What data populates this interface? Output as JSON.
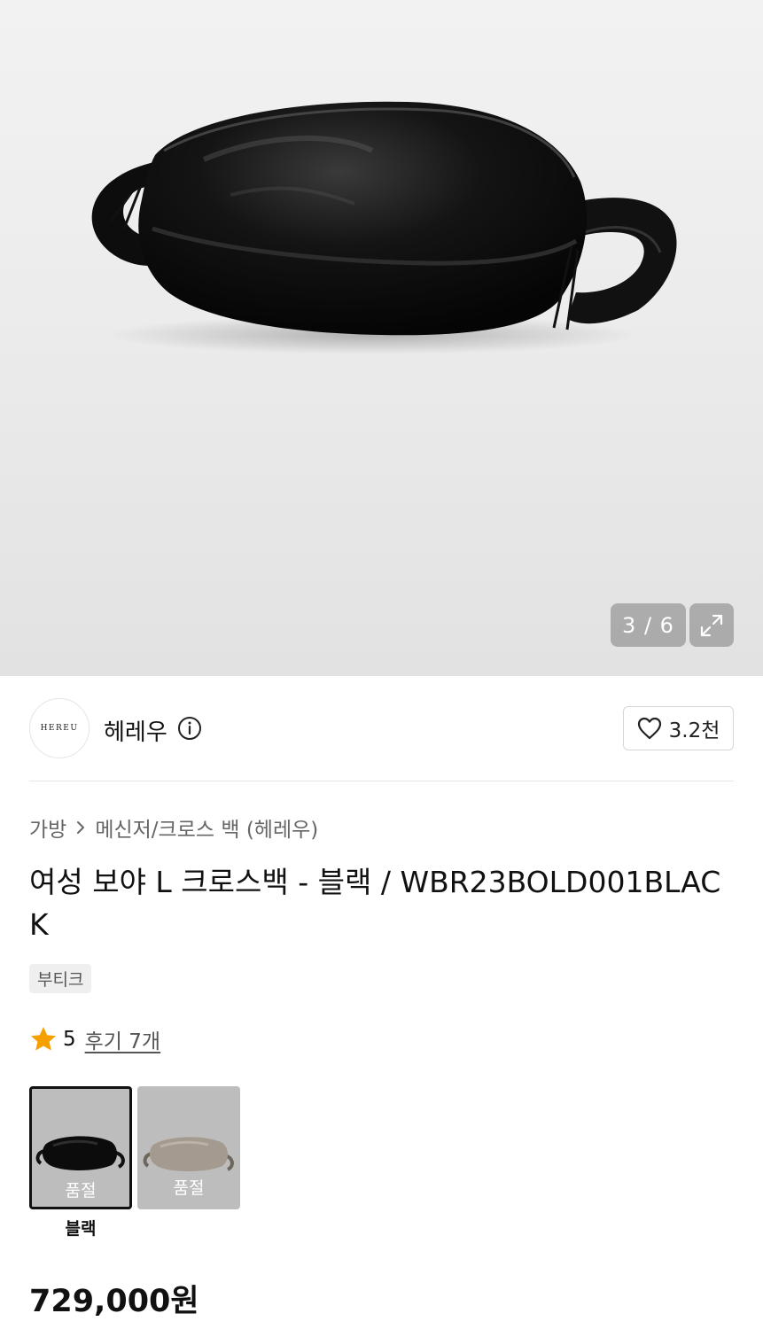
{
  "gallery": {
    "counter": "3 / 6",
    "expand_icon": "expand-icon"
  },
  "brand": {
    "logo_text": "HEREU",
    "name": "헤레우",
    "like_count": "3.2천"
  },
  "breadcrumb": {
    "items": [
      "가방",
      "메신저/크로스 백 (헤레우)"
    ]
  },
  "product": {
    "title": "여성 보야 L 크로스백 - 블랙 / WBR23BOLD001BLACK",
    "badge": "부티크",
    "rating": "5",
    "reviews": "후기 7개",
    "price": "729,000원"
  },
  "colors": {
    "star": "#F5A000",
    "selected_border": "#111111"
  },
  "options": [
    {
      "label": "품절",
      "caption": "블랙",
      "selected": true
    },
    {
      "label": "품절",
      "selected": false
    }
  ]
}
